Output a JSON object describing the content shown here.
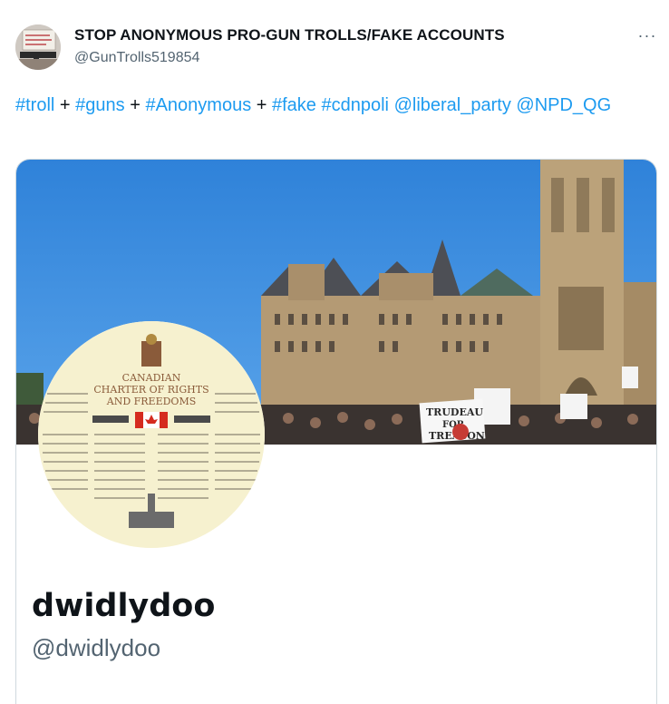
{
  "post": {
    "author": {
      "display_name": "STOP ANONYMOUS PRO-GUN TROLLS/FAKE ACCOUNTS",
      "handle": "@GunTrolls519854"
    },
    "more_label": "···",
    "text_parts": [
      {
        "text": "#troll",
        "link": true
      },
      {
        "text": " + ",
        "link": false
      },
      {
        "text": "#guns",
        "link": true
      },
      {
        "text": " + ",
        "link": false
      },
      {
        "text": "#Anonymous",
        "link": true
      },
      {
        "text": " + ",
        "link": false
      },
      {
        "text": "#fake",
        "link": true
      },
      {
        "text": " ",
        "link": false
      },
      {
        "text": "#cdnpoli",
        "link": true
      },
      {
        "text": " ",
        "link": false
      },
      {
        "text": "@liberal_party",
        "link": true
      },
      {
        "text": " ",
        "link": false
      },
      {
        "text": "@NPD_QG",
        "link": true
      }
    ]
  },
  "profile_card": {
    "name": "dwidlydoo",
    "handle": "@dwidlydoo",
    "banner_sign_text": [
      "TRUDEAU",
      "FOR",
      "TREASON"
    ],
    "avatar_text": [
      "CANADIAN",
      "CHARTER OF RIGHTS",
      "AND FREEDOMS"
    ]
  },
  "colors": {
    "link": "#1d9bf0",
    "text": "#0f1419",
    "secondary": "#536471",
    "border": "#cfd9de",
    "sky": "#3b8ee0"
  }
}
